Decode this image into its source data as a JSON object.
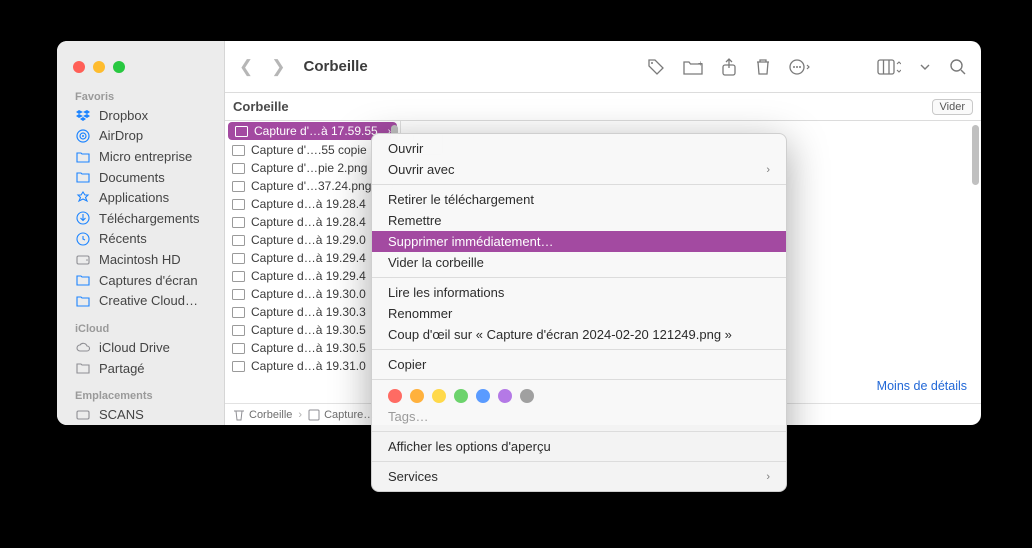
{
  "window_title": "Corbeille",
  "sidebar": {
    "sections": [
      {
        "label": "Favoris",
        "items": [
          {
            "icon": "dropbox-icon",
            "label": "Dropbox",
            "color": "blue"
          },
          {
            "icon": "airdrop-icon",
            "label": "AirDrop",
            "color": "blue"
          },
          {
            "icon": "folder-icon",
            "label": "Micro entreprise",
            "color": "blue"
          },
          {
            "icon": "folder-icon",
            "label": "Documents",
            "color": "blue"
          },
          {
            "icon": "app-icon",
            "label": "Applications",
            "color": "blue"
          },
          {
            "icon": "download-icon",
            "label": "Téléchargements",
            "color": "blue"
          },
          {
            "icon": "clock-icon",
            "label": "Récents",
            "color": "blue"
          },
          {
            "icon": "hdd-icon",
            "label": "Macintosh HD",
            "color": "grey"
          },
          {
            "icon": "folder-icon",
            "label": "Captures d'écran",
            "color": "blue"
          },
          {
            "icon": "folder-icon",
            "label": "Creative Cloud…",
            "color": "blue"
          }
        ]
      },
      {
        "label": "iCloud",
        "items": [
          {
            "icon": "cloud-icon",
            "label": "iCloud Drive",
            "color": "grey"
          },
          {
            "icon": "shared-icon",
            "label": "Partagé",
            "color": "grey"
          }
        ]
      },
      {
        "label": "Emplacements",
        "items": [
          {
            "icon": "hdd-icon",
            "label": "SCANS",
            "color": "grey"
          }
        ]
      }
    ]
  },
  "location_title": "Corbeille",
  "empty_button": "Vider",
  "files": [
    {
      "name": "Capture d'…à 17.59.55",
      "selected": true
    },
    {
      "name": "Capture d'….55 copie"
    },
    {
      "name": "Capture d'…pie 2.png"
    },
    {
      "name": "Capture d'…37.24.png"
    },
    {
      "name": "Capture d…à 19.28.4"
    },
    {
      "name": "Capture d…à 19.28.4"
    },
    {
      "name": "Capture d…à 19.29.0"
    },
    {
      "name": "Capture d…à 19.29.4"
    },
    {
      "name": "Capture d…à 19.29.4"
    },
    {
      "name": "Capture d…à 19.30.0"
    },
    {
      "name": "Capture d…à 19.30.3"
    },
    {
      "name": "Capture d…à 19.30.5"
    },
    {
      "name": "Capture d…à 19.30.5"
    },
    {
      "name": "Capture d…à 19.31.0"
    }
  ],
  "details_link": "Moins de détails",
  "pathbar": {
    "seg1": "Corbeille",
    "seg2": "Capture…"
  },
  "context_menu": {
    "open": "Ouvrir",
    "open_with": "Ouvrir avec",
    "remove_download": "Retirer le téléchargement",
    "put_back": "Remettre",
    "delete_immediately": "Supprimer immédiatement…",
    "empty_trash": "Vider la corbeille",
    "get_info": "Lire les informations",
    "rename": "Renommer",
    "quick_look": "Coup d'œil sur « Capture d'écran 2024-02-20 121249.png »",
    "copy": "Copier",
    "tags_label": "Tags…",
    "show_preview": "Afficher les options d'aperçu",
    "services": "Services",
    "tag_colors": [
      "#ff6b63",
      "#ffb13d",
      "#ffd94a",
      "#6cd36c",
      "#5a9bff",
      "#b479e6",
      "#a0a0a0"
    ]
  }
}
